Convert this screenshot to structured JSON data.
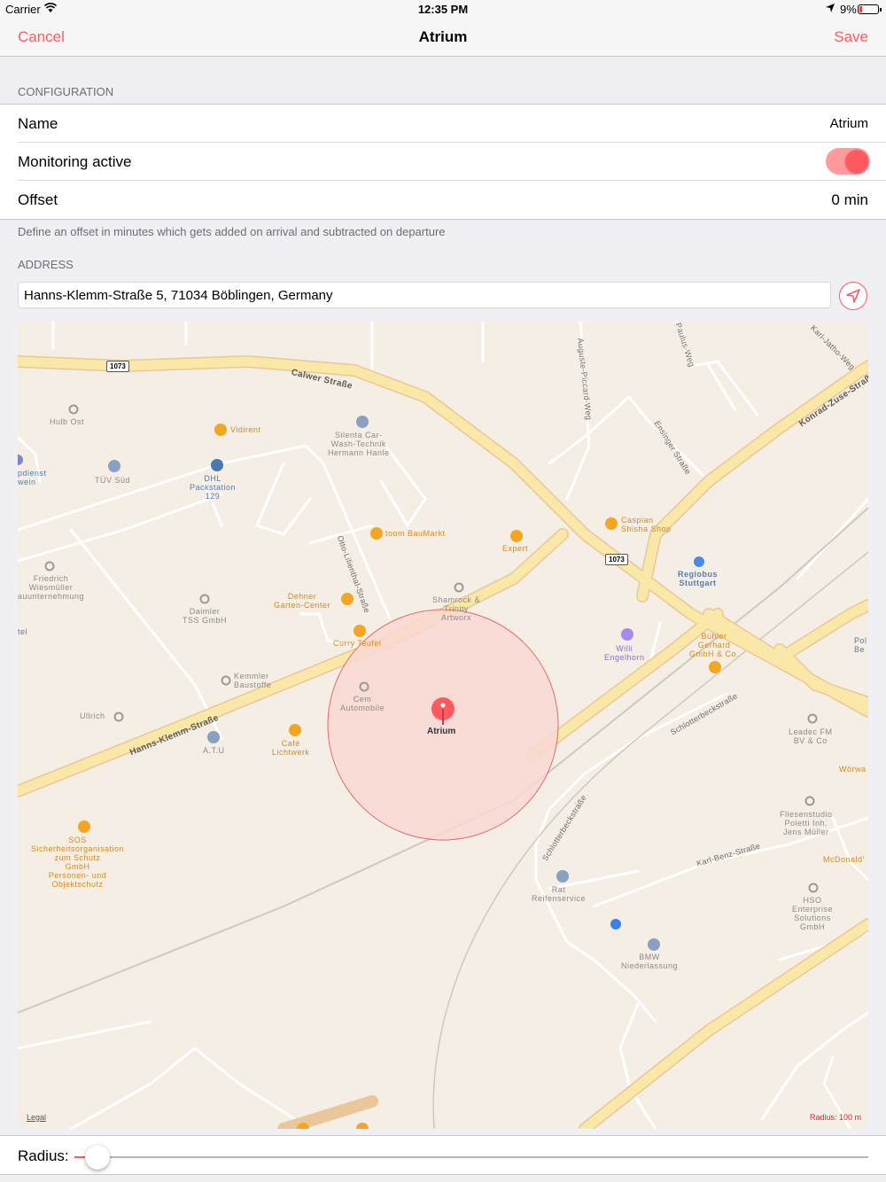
{
  "status_bar": {
    "carrier": "Carrier",
    "time": "12:35 PM",
    "battery": "9%"
  },
  "nav": {
    "cancel_label": "Cancel",
    "title": "Atrium",
    "save_label": "Save"
  },
  "configuration": {
    "header": "CONFIGURATION",
    "name_label": "Name",
    "name_value": "Atrium",
    "monitoring_label": "Monitoring active",
    "monitoring_active": true,
    "offset_label": "Offset",
    "offset_value": "0 min",
    "footer": "Define an offset in minutes which gets added on arrival and subtracted on departure"
  },
  "address": {
    "header": "ADDRESS",
    "value": "Hanns-Klemm-Straße 5, 71034 Böblingen, Germany"
  },
  "map": {
    "pin_label": "Atrium",
    "legal": "Legal",
    "radius_text": "Radius: 100 m",
    "route_shield": "1073",
    "streets": {
      "calwer": "Calwer Straße",
      "konrad": "Konrad-Zuse-Straße",
      "hanns": "Hanns-Klemm-Straße",
      "otto": "Otto-Lilienthal-Straße",
      "auguste": "Auguste-Piccard-Weg",
      "paulus": "Paulus-Weg",
      "karl_jatho": "Karl-Jatho-Weg",
      "ensinger": "Ensinger Straße",
      "schlotter1": "Schlotterbeckstraße",
      "schlotter2": "Schlotterbeckstraße",
      "karl_benz": "Karl-Benz-Straße"
    },
    "pois": {
      "hulb": "Hulb Ost",
      "vidirent": "Vidirent",
      "silenta": "Silenta Car-\nWash-Technik\nHermann Hanle",
      "dienst": "pdienst\nwein",
      "tuev": "TÜV Süd",
      "dhl": "DHL\nPackstation\n129",
      "toom": "toom BauMarkt",
      "expert": "Expert",
      "caspian": "Caspian\nShisha Shop",
      "regiobus": "Regiobus\nStuttgart",
      "friedrich": "Friedrich\nWiesmüller\nauunternehmung",
      "daimler": "Daimler\nTSS GmbH",
      "dehner": "Dehner\nGarten-Center",
      "shamrock": "Shamrock &\nTrinity\nArtworx",
      "curry": "Curry Teufel",
      "willi": "Willi\nEngelhorn",
      "buehler": "Bühler\nGerhard\nGmbH & Co.",
      "pol": "Pol\nBe",
      "tel": "tel",
      "kemmler": "Kemmler\nBaustoffe",
      "cem": "Cem\nAutomobile",
      "ullrich": "Ullrich",
      "atu": "A.T.U",
      "cafe": "Café\nLichtwerk",
      "leadec": "Leadec FM\nBV & Co",
      "woerwa": "Wörwa",
      "sos": "SOS\nSicherheitsorganisation\nzum Schutz\nGmbH\nPersonen- und\nObjektschutz",
      "fliesen": "Fliesenstudio\nPoletti Inh.\nJens Müller",
      "mcdonalds": "McDonald'",
      "rat": "Rat\nReifenservice",
      "hso": "HSO\nEnterprise\nSolutions\nGmbH",
      "bmw": "BMW\nNiederlassung"
    }
  },
  "radius": {
    "label": "Radius:",
    "value_fraction": 0.02
  },
  "colors": {
    "accent": "#ff5a5f",
    "geofence_fill": "#f9d8d3",
    "map_bg": "#f5eee4",
    "road_major": "#f9e8a8"
  }
}
